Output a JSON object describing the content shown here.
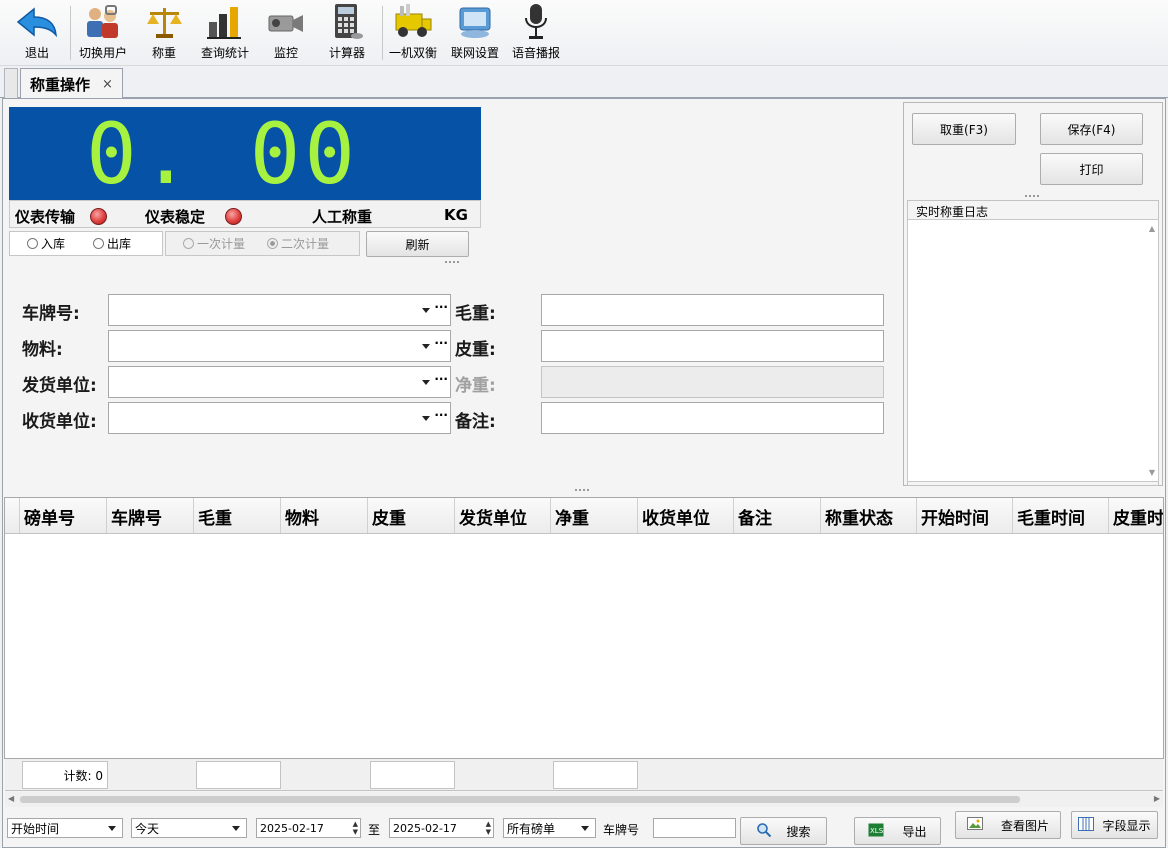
{
  "toolbar": {
    "items": [
      {
        "label": "退出",
        "icon": "exit-arrow-icon"
      },
      {
        "label": "切换用户",
        "icon": "switch-user-icon"
      },
      {
        "label": "称重",
        "icon": "scale-icon"
      },
      {
        "label": "查询统计",
        "icon": "stats-icon"
      },
      {
        "label": "监控",
        "icon": "camera-icon"
      },
      {
        "label": "计算器",
        "icon": "calculator-icon"
      },
      {
        "label": "一机双衡",
        "icon": "truck-icon"
      },
      {
        "label": "联网设置",
        "icon": "network-icon"
      },
      {
        "label": "语音播报",
        "icon": "microphone-icon"
      }
    ]
  },
  "tab": {
    "title": "称重操作",
    "close": "×"
  },
  "display": {
    "weight": "0. 00",
    "status": {
      "transmit_label": "仪表传输",
      "stable_label": "仪表稳定",
      "manual_label": "人工称重",
      "unit": "KG"
    }
  },
  "direction": {
    "in": "入库",
    "out": "出库"
  },
  "measure": {
    "once": "一次计量",
    "twice": "二次计量"
  },
  "buttons": {
    "refresh": "刷新",
    "tare": "取重(F3)",
    "save": "保存(F4)",
    "print": "打印"
  },
  "form": {
    "plate_label": "车牌号:",
    "material_label": "物料:",
    "sender_label": "发货单位:",
    "receiver_label": "收货单位:",
    "gross_label": "毛重:",
    "tare_label": "皮重:",
    "net_label": "净重:",
    "remark_label": "备注:",
    "more": "···"
  },
  "log": {
    "title": "实时称重日志"
  },
  "grid": {
    "columns": [
      "磅单号",
      "车牌号",
      "毛重",
      "物料",
      "皮重",
      "发货单位",
      "净重",
      "收货单位",
      "备注",
      "称重状态",
      "开始时间",
      "毛重时间",
      "皮重时间"
    ],
    "count_label": "计数: 0"
  },
  "bottom": {
    "time_field": "开始时间",
    "range": "今天",
    "date_from": "2025-02-17",
    "to_label": "至",
    "date_to": "2025-02-17",
    "bill_type": "所有磅单",
    "plate_label": "车牌号",
    "plate_value": "",
    "search": "搜索",
    "export": "导出",
    "view_image": "查看图片",
    "field_display": "字段显示"
  },
  "colors": {
    "display_bg": "#0652a6",
    "display_digits": "#a7f241",
    "led": "#e0403d"
  }
}
